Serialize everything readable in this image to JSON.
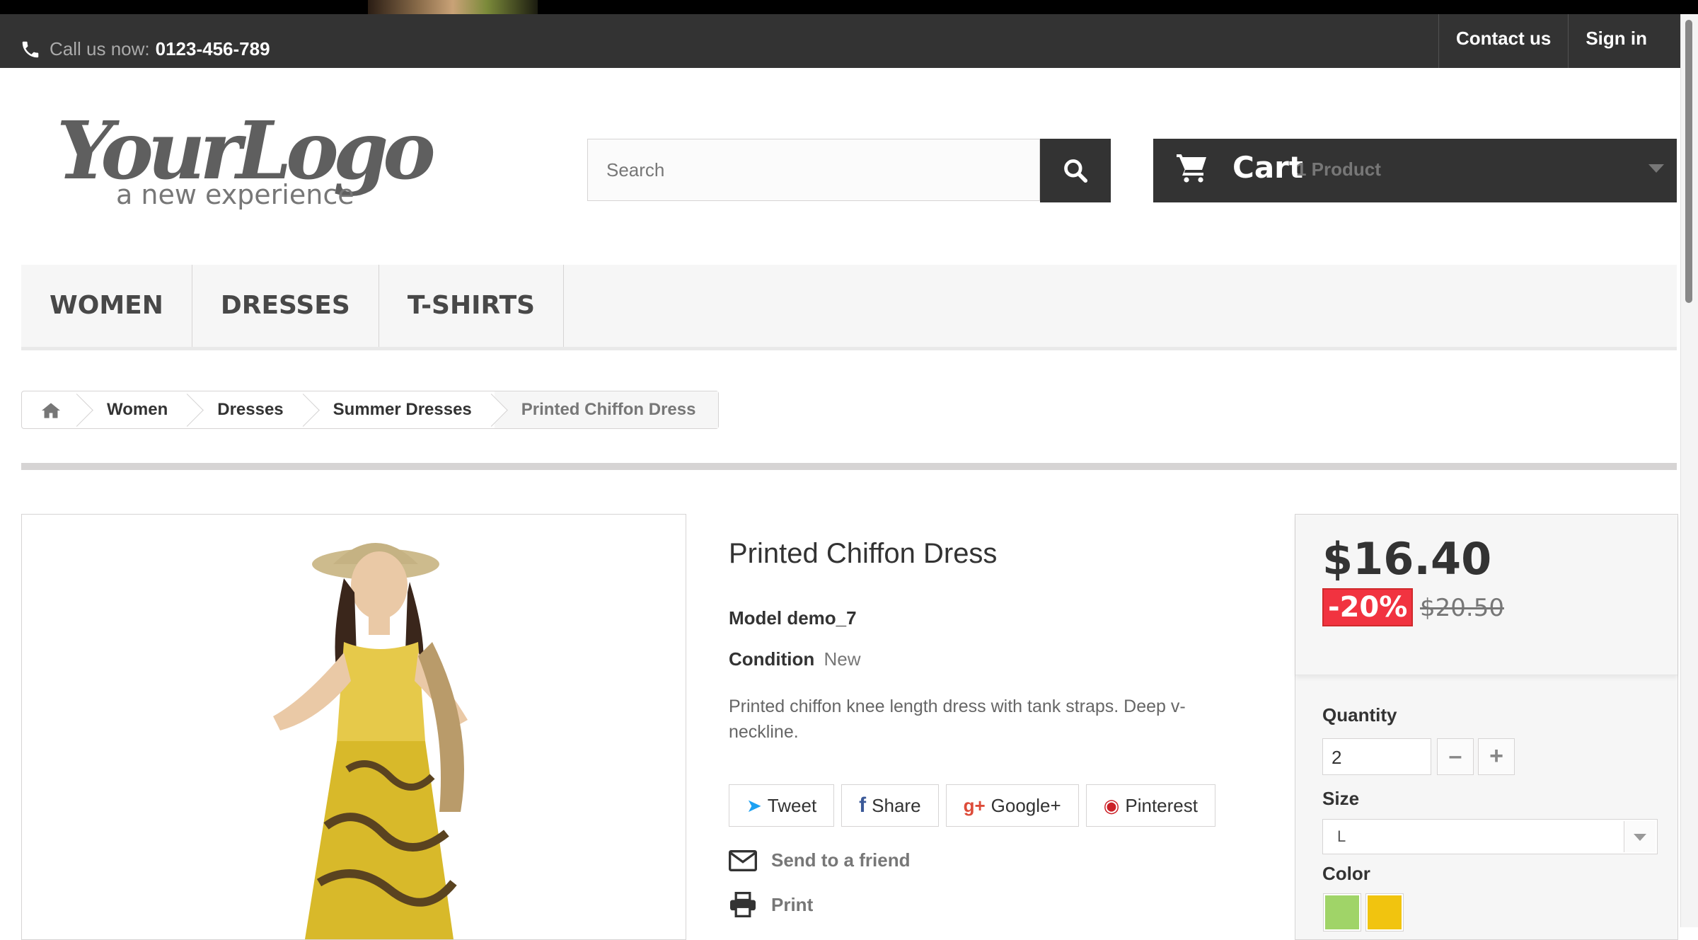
{
  "topbar": {
    "call_label": "Call us now:",
    "phone": "0123-456-789",
    "links": [
      "Contact us",
      "Sign in"
    ]
  },
  "logo": {
    "main": "YourLogo",
    "tagline": "a new experience"
  },
  "search": {
    "placeholder": "Search"
  },
  "cart": {
    "title": "Cart",
    "count": "1 Product"
  },
  "nav": {
    "items": [
      "WOMEN",
      "DRESSES",
      "T-SHIRTS"
    ]
  },
  "breadcrumb": {
    "items": [
      "Women",
      "Dresses",
      "Summer Dresses",
      "Printed Chiffon Dress"
    ]
  },
  "product": {
    "title": "Printed Chiffon Dress",
    "model_label": "Model",
    "model_value": "demo_7",
    "condition_label": "Condition",
    "condition_value": "New",
    "description": "Printed chiffon knee length dress with tank straps. Deep v-neckline.",
    "social": [
      "Tweet",
      "Share",
      "Google+",
      "Pinterest"
    ],
    "send_to_friend": "Send to a friend",
    "print": "Print"
  },
  "buy_box": {
    "price": "$16.40",
    "discount": "-20%",
    "old_price": "$20.50",
    "quantity_label": "Quantity",
    "quantity_value": "2",
    "size_label": "Size",
    "size_value": "L",
    "color_label": "Color",
    "colors": [
      "#a0d468",
      "#f1c40f"
    ]
  },
  "colors": {
    "topbar": "#333333",
    "discount": "#f13340",
    "accent_dark": "#333333"
  }
}
